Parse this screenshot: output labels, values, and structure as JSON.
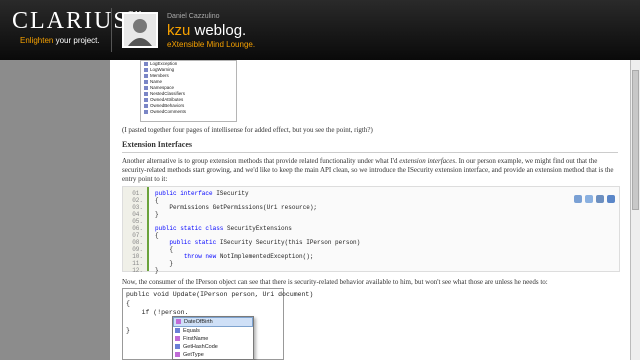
{
  "header": {
    "brand": "CLARIUS",
    "brand_tm": "TM",
    "tagline_hl": "Enlighten",
    "tagline_rest": " your project.",
    "author": "Daniel Cazzulino",
    "blog_kzu": "kzu",
    "blog_rest": " weblog.",
    "subtitle": "eXtensible Mind Lounge."
  },
  "intellisense_shot": {
    "items": [
      "LogException",
      "LogWarning",
      "Members",
      "Name",
      "Namespace",
      "NestedClassifiers",
      "OwnedAttributes",
      "OwnedBehaviors",
      "OwnedComments"
    ]
  },
  "post": {
    "p1": "(I pasted together four pages of intellisense for added effect, but you see the point, rigth?)",
    "heading": "Extension Interfaces",
    "p2_a": "Another alternative is to group extension methods that provide related functionality under what I'd ",
    "p2_em": "extension interfaces",
    "p2_b": ". In our person example, we might find out that the security-related methods start growing, and we'd like to keep the main API clean, so we introduce the ISecurity extension interface, and provide an extension method that is the entry point to it:",
    "p3": "Now, the consumer of the IPerson object can see that there is security-related behavior available to him, but won't see what those are unless he needs to:"
  },
  "code1": {
    "lines": [
      {
        "n": "01.",
        "pre": "",
        "kw": "public interface",
        "rest": " ISecurity"
      },
      {
        "n": "02.",
        "pre": "",
        "kw": "",
        "rest": "{"
      },
      {
        "n": "03.",
        "pre": "    ",
        "kw": "",
        "rest": "Permissions GetPermissions(Uri resource);"
      },
      {
        "n": "04.",
        "pre": "",
        "kw": "",
        "rest": "}"
      },
      {
        "n": "05.",
        "pre": "",
        "kw": "",
        "rest": ""
      },
      {
        "n": "06.",
        "pre": "",
        "kw": "public static class",
        "rest": " SecurityExtensions"
      },
      {
        "n": "07.",
        "pre": "",
        "kw": "",
        "rest": "{"
      },
      {
        "n": "08.",
        "pre": "    ",
        "kw": "public static",
        "rest": " ISecurity Security(this IPerson person)"
      },
      {
        "n": "09.",
        "pre": "    ",
        "kw": "",
        "rest": "{"
      },
      {
        "n": "10.",
        "pre": "        ",
        "kw": "throw new",
        "rest": " NotImplementedException();"
      },
      {
        "n": "11.",
        "pre": "    ",
        "kw": "",
        "rest": "}"
      },
      {
        "n": "12.",
        "pre": "",
        "kw": "",
        "rest": "}"
      }
    ]
  },
  "code2": {
    "line1": "public void Update(IPerson person, Uri document)",
    "line2": "{",
    "line3": "    if (!person.",
    "line4": "}"
  },
  "intellisense": {
    "items": [
      "DateOfBirth",
      "Equals",
      "FirstName",
      "GetHashCode",
      "GetType"
    ],
    "selected": 0
  },
  "colors": {
    "accent": "#f5a000",
    "gutter_border": "#6ba33b",
    "keyword": "#0000ff"
  }
}
